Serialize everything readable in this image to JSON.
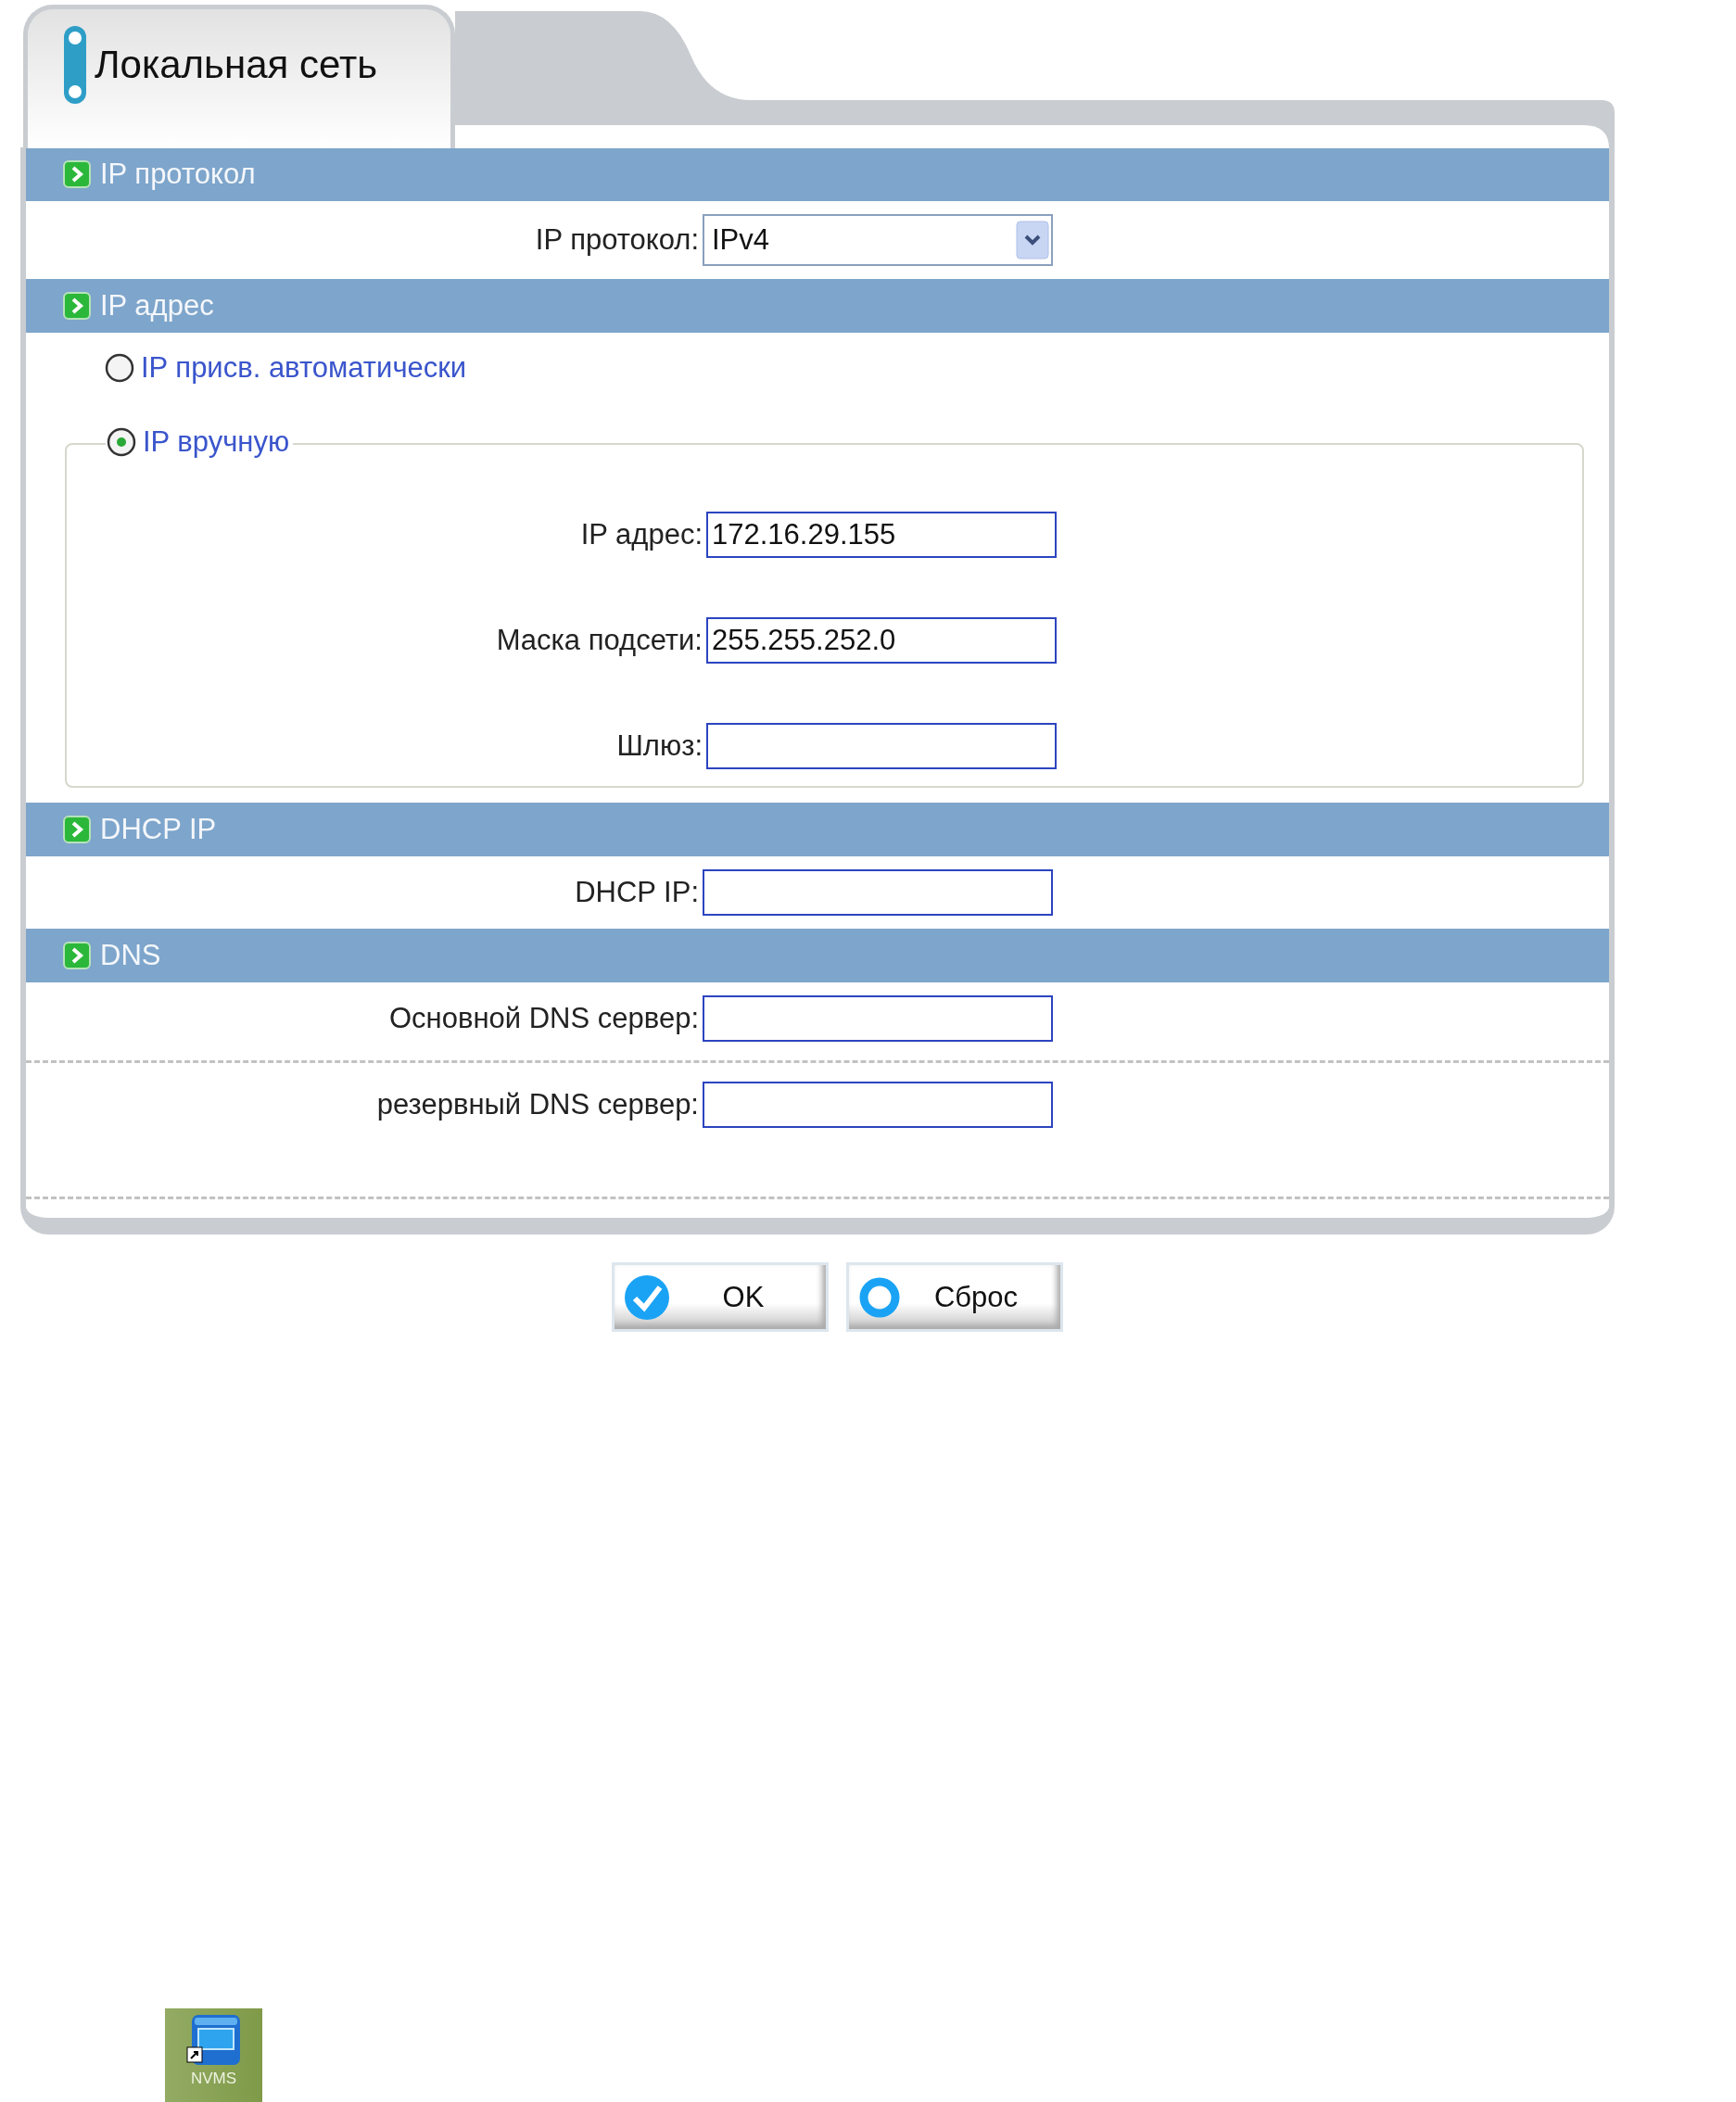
{
  "tab": {
    "title": "Локальная сеть"
  },
  "sections": [
    {
      "title": "IP протокол",
      "items": [
        {
          "kind": "select",
          "label": "IP протокол:",
          "value": "IPv4"
        }
      ]
    },
    {
      "title": "IP адрес",
      "items": [
        {
          "kind": "radio",
          "label": "IP присв. автоматически",
          "selected": false
        },
        {
          "kind": "radio_group",
          "label": "IP вручную",
          "selected": true,
          "fields": [
            {
              "label": "IP адрес:",
              "value": "172.16.29.155"
            },
            {
              "label": "Маска подсети:",
              "value": "255.255.252.0"
            },
            {
              "label": "Шлюз:"
            }
          ]
        }
      ]
    },
    {
      "title": "DHCP IP",
      "items": [
        {
          "kind": "field",
          "label": "DHCP IP:"
        }
      ]
    },
    {
      "title": "DNS",
      "items": [
        {
          "kind": "field",
          "label": "Основной DNS сервер:"
        },
        {
          "kind": "divider"
        },
        {
          "kind": "field",
          "label": "резервный DNS сервер:"
        },
        {
          "kind": "divider"
        }
      ]
    }
  ],
  "buttons": [
    {
      "kind": "confirm",
      "label": "OK"
    },
    {
      "kind": "reset",
      "label": "Сброс"
    }
  ],
  "desktop_shortcut": {
    "label": "NVMS"
  }
}
